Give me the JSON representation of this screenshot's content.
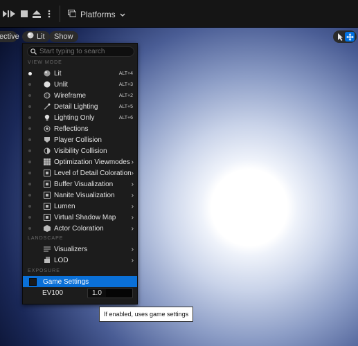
{
  "toolbar": {
    "platforms_label": "Platforms",
    "icons": [
      "play-step-icon",
      "skip-icon",
      "stop-icon",
      "eject-icon",
      "more-icon",
      "platforms-icon",
      "chevron-down-icon"
    ]
  },
  "viewport_bar": {
    "perspective_label": "ective",
    "lit_label": "Lit",
    "show_label": "Show"
  },
  "menu": {
    "search_placeholder": "Start typing to search",
    "view_mode_header": "VIEW MODE",
    "view_modes": [
      {
        "label": "Lit",
        "shortcut": "ALT+4",
        "selected": true,
        "icon": "lit-sphere-icon"
      },
      {
        "label": "Unlit",
        "shortcut": "ALT+3",
        "selected": false,
        "icon": "unlit-sphere-icon"
      },
      {
        "label": "Wireframe",
        "shortcut": "ALT+2",
        "selected": false,
        "icon": "wireframe-sphere-icon"
      },
      {
        "label": "Detail Lighting",
        "shortcut": "ALT+5",
        "selected": false,
        "icon": "detail-lighting-icon"
      },
      {
        "label": "Lighting Only",
        "shortcut": "ALT+6",
        "selected": false,
        "icon": "lightbulb-icon"
      },
      {
        "label": "Reflections",
        "shortcut": "",
        "selected": false,
        "icon": "reflections-icon"
      },
      {
        "label": "Player Collision",
        "shortcut": "",
        "selected": false,
        "icon": "player-collision-icon"
      },
      {
        "label": "Visibility Collision",
        "shortcut": "",
        "selected": false,
        "icon": "visibility-collision-icon"
      },
      {
        "label": "Optimization Viewmodes",
        "submenu": true,
        "selected": false,
        "icon": "grid-icon"
      },
      {
        "label": "Level of Detail Coloration",
        "submenu": true,
        "selected": false,
        "icon": "lod-coloration-icon"
      },
      {
        "label": "Buffer Visualization",
        "submenu": true,
        "selected": false,
        "icon": "buffer-icon"
      },
      {
        "label": "Nanite Visualization",
        "submenu": true,
        "selected": false,
        "icon": "nanite-icon"
      },
      {
        "label": "Lumen",
        "submenu": true,
        "selected": false,
        "icon": "lumen-icon"
      },
      {
        "label": "Virtual Shadow Map",
        "submenu": true,
        "selected": false,
        "icon": "shadow-map-icon"
      },
      {
        "label": "Actor Coloration",
        "submenu": true,
        "selected": false,
        "icon": "actor-coloration-icon"
      }
    ],
    "landscape_header": "LANDSCAPE",
    "landscape_items": [
      {
        "label": "Visualizers",
        "submenu": true,
        "icon": "visualizers-icon"
      },
      {
        "label": "LOD",
        "submenu": true,
        "icon": "lod-icon"
      }
    ],
    "exposure_header": "EXPOSURE",
    "game_settings_label": "Game Settings",
    "ev100_label": "EV100",
    "ev100_value": "1.0"
  },
  "tooltip": "If enabled, uses game settings",
  "colors": {
    "accent": "#0a70d8",
    "menu_bg": "#1c1c1c",
    "toolbar_bg": "#151515"
  }
}
